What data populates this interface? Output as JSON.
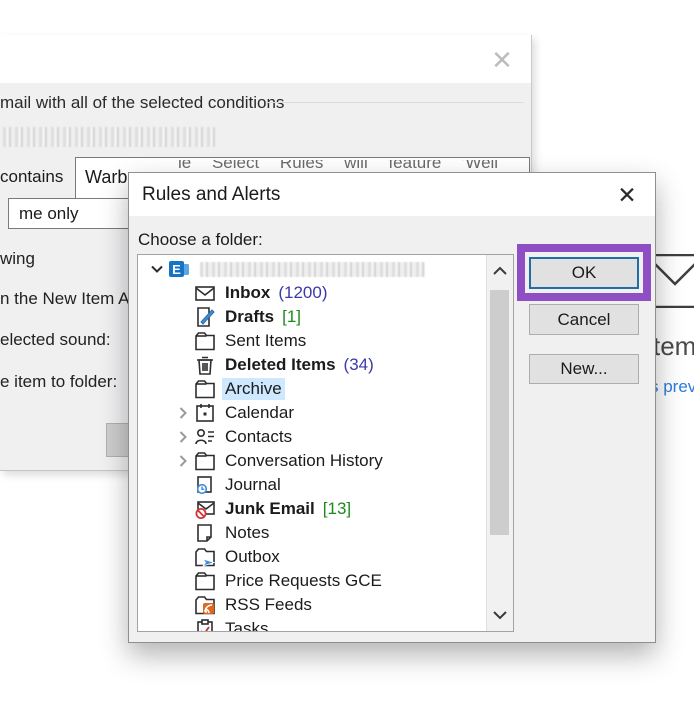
{
  "colors": {
    "annotation_purple": "#8e4ec4",
    "ok_focus_border": "#1f6ea5",
    "selection_blue": "#cde8ff",
    "count_navy": "#3a3aa8",
    "count_green": "#1d8a1d",
    "link_blue": "#2c7bdf"
  },
  "page_background": {
    "heading_fragment": "tem",
    "link_fragment": "s prev",
    "envelope_icon": "envelope-outline"
  },
  "background_dialog": {
    "close_icon": "✕",
    "group_caption": "mail with all of the selected conditions",
    "contains_label": "contains",
    "contains_value": "Warbu",
    "clipped_text_fragment": "le Select Rules will feature 'Well",
    "dropdown_value": "me only",
    "label_following": "wing",
    "label_new_item": "n the New Item Al",
    "label_sound": "elected sound:",
    "label_folder": "e item to folder:"
  },
  "dialog": {
    "title": "Rules and Alerts",
    "close_icon": "✕",
    "prompt": "Choose a folder:",
    "tree": [
      {
        "type": "root",
        "icon": "exchange",
        "chevron": "down",
        "redacted": true,
        "label": ""
      },
      {
        "label": "Inbox",
        "icon": "inbox",
        "bold": true,
        "count": "(1200)",
        "count_color": "navy"
      },
      {
        "label": "Drafts",
        "icon": "drafts",
        "bold": true,
        "count": "[1]",
        "count_color": "green"
      },
      {
        "label": "Sent Items",
        "icon": "folder"
      },
      {
        "label": "Deleted Items",
        "icon": "trash",
        "bold": true,
        "count": "(34)",
        "count_color": "navy"
      },
      {
        "label": "Archive",
        "icon": "folder",
        "selected": true
      },
      {
        "label": "Calendar",
        "icon": "calendar",
        "chevron": "right"
      },
      {
        "label": "Contacts",
        "icon": "contacts",
        "chevron": "right"
      },
      {
        "label": "Conversation History",
        "icon": "folder",
        "chevron": "right"
      },
      {
        "label": "Journal",
        "icon": "journal"
      },
      {
        "label": "Junk Email",
        "icon": "junk",
        "bold": true,
        "count": "[13]",
        "count_color": "green"
      },
      {
        "label": "Notes",
        "icon": "note"
      },
      {
        "label": "Outbox",
        "icon": "outbox"
      },
      {
        "label": "Price Requests GCE",
        "icon": "folder"
      },
      {
        "label": "RSS Feeds",
        "icon": "rss"
      },
      {
        "label": "Tasks",
        "icon": "tasks",
        "clipped": true
      }
    ],
    "buttons": [
      {
        "label": "OK"
      },
      {
        "label": "Cancel"
      },
      {
        "label": "New..."
      }
    ],
    "scrollbar": {
      "up_icon": "chevron-up",
      "down_icon": "chevron-down"
    }
  }
}
